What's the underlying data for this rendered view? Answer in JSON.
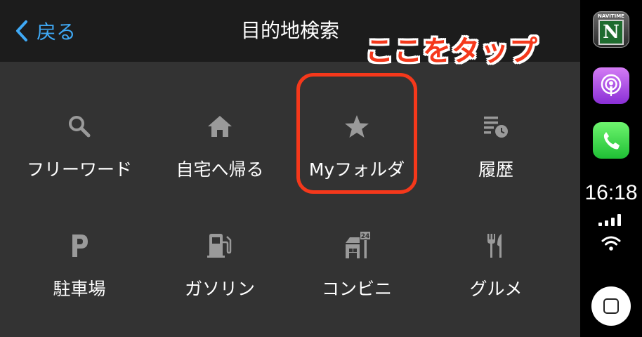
{
  "header": {
    "back_label": "戻る",
    "title": "目的地検索"
  },
  "annotation": {
    "callout_text": "ここをタップ",
    "color": "#f5381b"
  },
  "grid": {
    "items": [
      {
        "label": "フリーワード",
        "icon": "search-icon"
      },
      {
        "label": "自宅へ帰る",
        "icon": "home-icon"
      },
      {
        "label": "Myフォルダ",
        "icon": "star-icon",
        "highlighted": true
      },
      {
        "label": "履歴",
        "icon": "history-icon"
      },
      {
        "label": "駐車場",
        "icon": "parking-icon"
      },
      {
        "label": "ガソリン",
        "icon": "gas-station-icon"
      },
      {
        "label": "コンビニ",
        "icon": "convenience-store-icon"
      },
      {
        "label": "グルメ",
        "icon": "restaurant-icon"
      }
    ]
  },
  "sidebar": {
    "apps": [
      {
        "name": "navitime-app-icon",
        "label": "NAVITIME",
        "letter": "N"
      },
      {
        "name": "podcasts-app-icon"
      },
      {
        "name": "phone-app-icon"
      }
    ],
    "time": "16:18",
    "icon_24": "24"
  },
  "colors": {
    "accent": "#3fa9f5",
    "background": "#333333",
    "header": "#1c1c1c",
    "icon_gray": "#9a9a9a"
  }
}
